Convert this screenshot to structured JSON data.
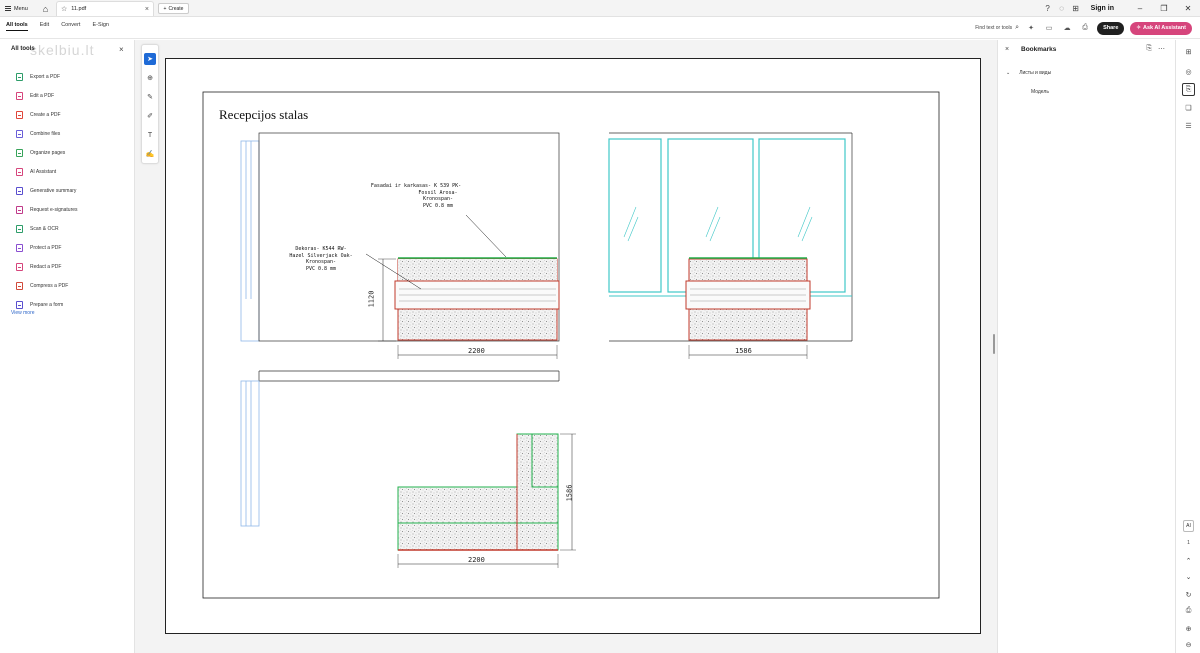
{
  "titlebar": {
    "menu_label": "Menu",
    "tab_title": "11.pdf",
    "create_label": "Create",
    "signin_label": "Sign in"
  },
  "menubar": {
    "tabs": [
      "All tools",
      "Edit",
      "Convert",
      "E-Sign"
    ],
    "find_label": "Find text or tools",
    "share_label": "Share",
    "ai_label": "Ask AI Assistant"
  },
  "leftpanel": {
    "title": "All tools",
    "watermark": "skelbiu.lt",
    "items": [
      {
        "label": "Export a PDF",
        "color": "#2e9d6a",
        "icon": "export-pdf-icon"
      },
      {
        "label": "Edit a PDF",
        "color": "#d6457c",
        "icon": "edit-pdf-icon"
      },
      {
        "label": "Create a PDF",
        "color": "#e0463a",
        "icon": "create-pdf-icon"
      },
      {
        "label": "Combine files",
        "color": "#6a5ed8",
        "icon": "combine-files-icon"
      },
      {
        "label": "Organize pages",
        "color": "#38a35a",
        "icon": "organize-pages-icon"
      },
      {
        "label": "AI Assistant",
        "color": "#d6457c",
        "icon": "ai-assistant-icon"
      },
      {
        "label": "Generative summary",
        "color": "#5a4fcf",
        "icon": "generative-summary-icon"
      },
      {
        "label": "Request e-signatures",
        "color": "#c03a8a",
        "icon": "request-esignatures-icon"
      },
      {
        "label": "Scan & OCR",
        "color": "#2e9d6a",
        "icon": "scan-ocr-icon"
      },
      {
        "label": "Protect a PDF",
        "color": "#8a4fd1",
        "icon": "protect-pdf-icon"
      },
      {
        "label": "Redact a PDF",
        "color": "#d6457c",
        "icon": "redact-pdf-icon"
      },
      {
        "label": "Compress a PDF",
        "color": "#d14a3b",
        "icon": "compress-pdf-icon"
      },
      {
        "label": "Prepare a form",
        "color": "#5a4fcf",
        "icon": "prepare-form-icon"
      }
    ],
    "view_more": "View more"
  },
  "drawing": {
    "title": "Recepcijos stalas",
    "annotation_top": [
      "Fasadai ir karkasas- K 539 PK-",
      "Fossil Arosa-",
      "Kronospan-",
      "PVC 0.8 mm"
    ],
    "annotation_mid": [
      "Dekoras- K544 RW-",
      "Hazel Silverjack Oak-",
      "Kronospan-",
      "PVC 0.8 mm"
    ],
    "dim_height": "1120",
    "dim_width_front": "2200",
    "dim_width_side": "1586",
    "dim_plan_width": "2200",
    "dim_plan_depth": "1586",
    "colors": {
      "outline": "#c0392b",
      "top": "#22b14c",
      "glass": "#3fc7c7",
      "wall": "#8fb8e8"
    }
  },
  "bookmarks": {
    "title": "Bookmarks",
    "item_group": "Листы и виды",
    "item_model": "Модель"
  },
  "rightrail": {
    "aa_label": "AI",
    "page_number": "1"
  }
}
